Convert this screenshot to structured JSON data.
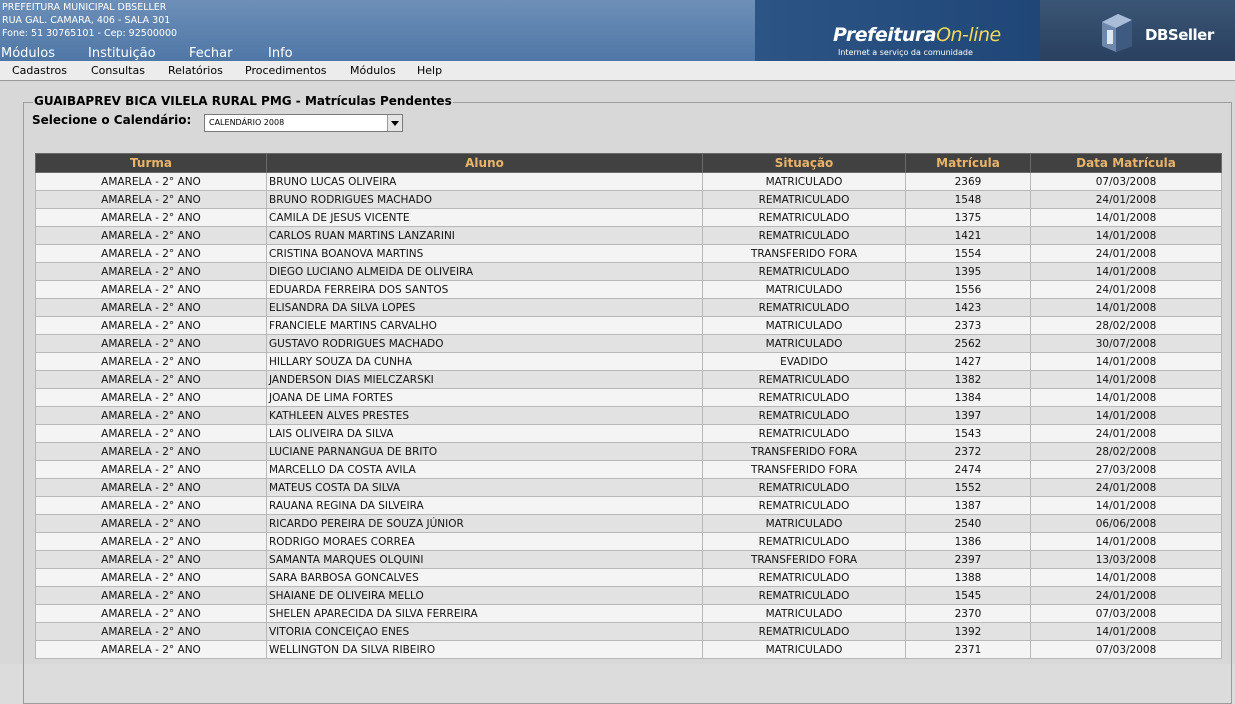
{
  "header": {
    "org_name": "PREFEITURA MUNICIPAL DBSELLER",
    "address": "RUA GAL. CAMARA, 406 - SALA 301",
    "contact": "Fone: 51 30765101  -  Cep: 92500000",
    "top_nav": [
      "Módulos",
      "Instituição",
      "Fechar",
      "Info"
    ],
    "logo_main": "Prefeitura",
    "logo_online": "On-line",
    "logo_tagline": "Internet a serviço da comunidade",
    "brand": "DBSeller"
  },
  "menu": [
    "Cadastros",
    "Consultas",
    "Relatórios",
    "Procedimentos",
    "Módulos",
    "Help"
  ],
  "page": {
    "legend": "GUAIBAPREV BICA VILELA RURAL PMG - Matrículas Pendentes",
    "calendar_label": "Selecione o Calendário:",
    "calendar_value": "CALENDÁRIO 2008"
  },
  "table": {
    "columns": [
      "Turma",
      "Aluno",
      "Situação",
      "Matrícula",
      "Data Matrícula"
    ],
    "rows": [
      [
        "AMARELA - 2° ANO",
        "BRUNO LUCAS OLIVEIRA",
        "MATRICULADO",
        "2369",
        "07/03/2008"
      ],
      [
        "AMARELA - 2° ANO",
        "BRUNO RODRIGUES MACHADO",
        "REMATRICULADO",
        "1548",
        "24/01/2008"
      ],
      [
        "AMARELA - 2° ANO",
        "CAMILA DE JESUS VICENTE",
        "REMATRICULADO",
        "1375",
        "14/01/2008"
      ],
      [
        "AMARELA - 2° ANO",
        "CARLOS RUAN MARTINS LANZARINI",
        "REMATRICULADO",
        "1421",
        "14/01/2008"
      ],
      [
        "AMARELA - 2° ANO",
        "CRISTINA BOANOVA MARTINS",
        "TRANSFERIDO FORA",
        "1554",
        "24/01/2008"
      ],
      [
        "AMARELA - 2° ANO",
        "DIEGO LUCIANO ALMEIDA DE OLIVEIRA",
        "REMATRICULADO",
        "1395",
        "14/01/2008"
      ],
      [
        "AMARELA - 2° ANO",
        "EDUARDA FERREIRA DOS SANTOS",
        "MATRICULADO",
        "1556",
        "24/01/2008"
      ],
      [
        "AMARELA - 2° ANO",
        "ELISANDRA DA SILVA LOPES",
        "REMATRICULADO",
        "1423",
        "14/01/2008"
      ],
      [
        "AMARELA - 2° ANO",
        "FRANCIELE MARTINS CARVALHO",
        "MATRICULADO",
        "2373",
        "28/02/2008"
      ],
      [
        "AMARELA - 2° ANO",
        "GUSTAVO RODRIGUES MACHADO",
        "MATRICULADO",
        "2562",
        "30/07/2008"
      ],
      [
        "AMARELA - 2° ANO",
        "HILLARY SOUZA DA CUNHA",
        "EVADIDO",
        "1427",
        "14/01/2008"
      ],
      [
        "AMARELA - 2° ANO",
        "JANDERSON DIAS MIELCZARSKI",
        "REMATRICULADO",
        "1382",
        "14/01/2008"
      ],
      [
        "AMARELA - 2° ANO",
        "JOANA DE LIMA FORTES",
        "REMATRICULADO",
        "1384",
        "14/01/2008"
      ],
      [
        "AMARELA - 2° ANO",
        "KATHLEEN ALVES PRESTES",
        "REMATRICULADO",
        "1397",
        "14/01/2008"
      ],
      [
        "AMARELA - 2° ANO",
        "LAIS OLIVEIRA DA SILVA",
        "REMATRICULADO",
        "1543",
        "24/01/2008"
      ],
      [
        "AMARELA - 2° ANO",
        "LUCIANE PARNANGUA DE BRITO",
        "TRANSFERIDO FORA",
        "2372",
        "28/02/2008"
      ],
      [
        "AMARELA - 2° ANO",
        "MARCELLO DA COSTA AVILA",
        "TRANSFERIDO FORA",
        "2474",
        "27/03/2008"
      ],
      [
        "AMARELA - 2° ANO",
        "MATEUS COSTA DA SILVA",
        "REMATRICULADO",
        "1552",
        "24/01/2008"
      ],
      [
        "AMARELA - 2° ANO",
        "RAUANA REGINA DA SILVEIRA",
        "REMATRICULADO",
        "1387",
        "14/01/2008"
      ],
      [
        "AMARELA - 2° ANO",
        "RICARDO PEREIRA DE SOUZA JÚNIOR",
        "MATRICULADO",
        "2540",
        "06/06/2008"
      ],
      [
        "AMARELA - 2° ANO",
        "RODRIGO MORAES CORREA",
        "REMATRICULADO",
        "1386",
        "14/01/2008"
      ],
      [
        "AMARELA - 2° ANO",
        "SAMANTA MARQUES OLQUINI",
        "TRANSFERIDO FORA",
        "2397",
        "13/03/2008"
      ],
      [
        "AMARELA - 2° ANO",
        "SARA BARBOSA GONCALVES",
        "REMATRICULADO",
        "1388",
        "14/01/2008"
      ],
      [
        "AMARELA - 2° ANO",
        "SHAIANE DE OLIVEIRA MELLO",
        "REMATRICULADO",
        "1545",
        "24/01/2008"
      ],
      [
        "AMARELA - 2° ANO",
        "SHELEN APARECIDA DA SILVA FERREIRA",
        "MATRICULADO",
        "2370",
        "07/03/2008"
      ],
      [
        "AMARELA - 2° ANO",
        "VITORIA CONCEIÇAO ENES",
        "REMATRICULADO",
        "1392",
        "14/01/2008"
      ],
      [
        "AMARELA - 2° ANO",
        "WELLINGTON DA SILVA RIBEIRO",
        "MATRICULADO",
        "2371",
        "07/03/2008"
      ]
    ]
  },
  "colors": {
    "header_bg": "#4f77a6",
    "table_header_bg": "#414141",
    "table_header_text": "#e8b46a",
    "logo_accent": "#f3d95a"
  }
}
